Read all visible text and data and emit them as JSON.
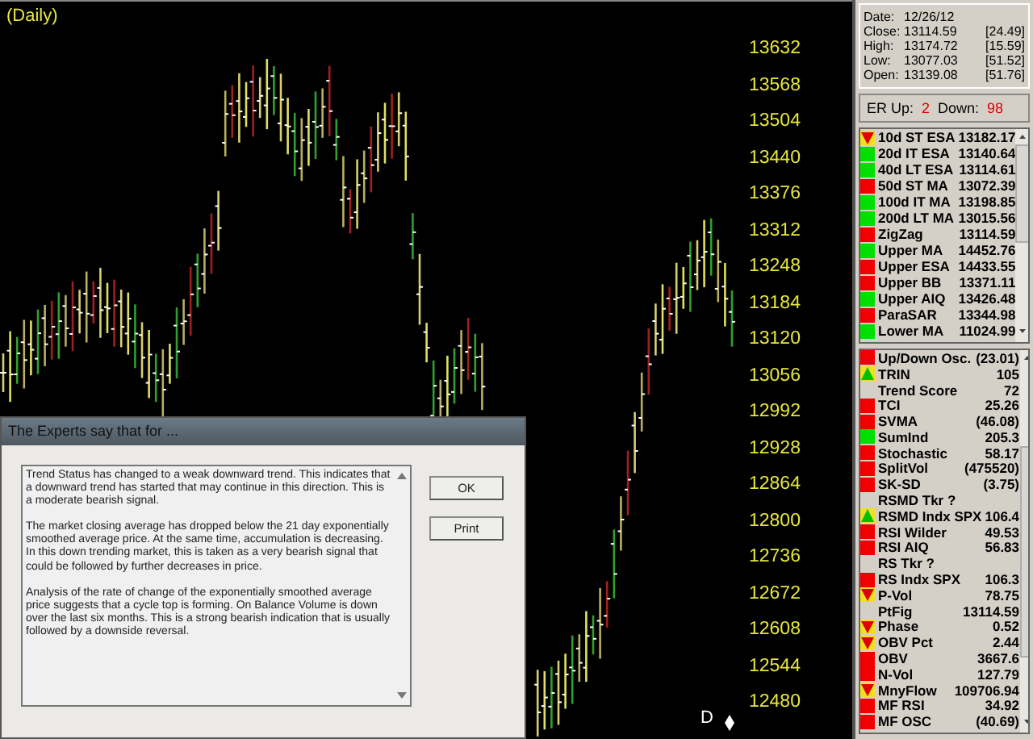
{
  "chart": {
    "period": "(Daily)",
    "price_axis": [
      "13632",
      "13568",
      "13504",
      "13440",
      "13376",
      "13312",
      "13248",
      "13184",
      "13120",
      "13056",
      "12992",
      "12928",
      "12864",
      "12800",
      "12736",
      "12672",
      "12608",
      "12544",
      "12480"
    ],
    "date_marker": "D"
  },
  "dialog": {
    "title": "The Experts say that for ...",
    "paragraphs": [
      "Trend Status has changed to a weak downward trend.  This indicates that a downward trend has started that may continue in this direction.  This is a moderate bearish signal.",
      "The market closing average has dropped below the 21  day exponentially smoothed average price.  At the  same time, accumulation is decreasing. In this down trending market, this is taken as a very bearish signal that could be followed by further decreases in price.",
      "Analysis of the rate of change of the exponentially smoothed average price suggests that a cycle top is forming.  On Balance Volume is down over the last six months. This is a strong bearish indication  that is usually followed by a downside reversal."
    ],
    "buttons": [
      "OK",
      "Print"
    ]
  },
  "quote": [
    {
      "label": "Date:",
      "value": "12/26/12"
    },
    {
      "label": "Close:",
      "value": "13114.59",
      "change": "[24.49]"
    },
    {
      "label": "High:",
      "value": "13174.72",
      "change": "[15.59]"
    },
    {
      "label": "Low:",
      "value": "13077.03",
      "change": "[51.52]"
    },
    {
      "label": "Open:",
      "value": "13139.08",
      "change": "[51.76]"
    }
  ],
  "expert_rating": {
    "up_label": "ER Up:",
    "up": "2",
    "down_label": "Down:",
    "down": "98"
  },
  "indicators": [
    {
      "kind": "falling",
      "name": "10d ST ESA",
      "value": "13182.17"
    },
    {
      "kind": "bullish",
      "name": "20d IT ESA",
      "value": "13140.64"
    },
    {
      "kind": "bullish",
      "name": "40d LT ESA",
      "value": "13114.61"
    },
    {
      "kind": "bearish",
      "name": "50d ST MA",
      "value": "13072.39"
    },
    {
      "kind": "bullish",
      "name": "100d IT MA",
      "value": "13198.85"
    },
    {
      "kind": "bullish",
      "name": "200d LT MA",
      "value": "13015.56"
    },
    {
      "kind": "bearish",
      "name": "ZigZag",
      "value": "13114.59"
    },
    {
      "kind": "bullish",
      "name": "Upper MA",
      "value": "14452.76"
    },
    {
      "kind": "bearish",
      "name": "Upper ESA",
      "value": "14433.55"
    },
    {
      "kind": "bearish",
      "name": "Upper BB",
      "value": "13371.11"
    },
    {
      "kind": "bullish",
      "name": "Upper AIQ",
      "value": "13426.48"
    },
    {
      "kind": "bearish",
      "name": "ParaSAR",
      "value": "13344.98"
    },
    {
      "kind": "bullish",
      "name": "Lower MA",
      "value": "11024.99"
    }
  ],
  "oscillators": [
    {
      "kind": "bearish",
      "name": "Up/Down Osc.",
      "value": "(23.01)"
    },
    {
      "kind": "rising",
      "name": "TRIN",
      "value": "105"
    },
    {
      "kind": "none",
      "name": "Trend Score",
      "value": "72"
    },
    {
      "kind": "bearish",
      "name": "TCI",
      "value": "25.26"
    },
    {
      "kind": "bearish",
      "name": "SVMA",
      "value": "(46.08)"
    },
    {
      "kind": "bullish",
      "name": "SumInd",
      "value": "205.3"
    },
    {
      "kind": "bearish",
      "name": "Stochastic",
      "value": "58.17"
    },
    {
      "kind": "bearish",
      "name": "SplitVol",
      "value": "(475520)"
    },
    {
      "kind": "bearish",
      "name": "SK-SD",
      "value": "(3.75)"
    },
    {
      "kind": "none",
      "name": "RSMD Tkr ?"
    },
    {
      "kind": "rising",
      "name": "RSMD Indx SPX",
      "value": "106.4"
    },
    {
      "kind": "bearish",
      "name": "RSI Wilder",
      "value": "49.53"
    },
    {
      "kind": "bearish",
      "name": "RSI AIQ",
      "value": "56.83"
    },
    {
      "kind": "none",
      "name": "RS Tkr ?"
    },
    {
      "kind": "bearish",
      "name": "RS Indx SPX",
      "value": "106.3"
    },
    {
      "kind": "falling",
      "name": "P-Vol",
      "value": "78.75"
    },
    {
      "kind": "none",
      "name": "PtFig",
      "value": "13114.59"
    },
    {
      "kind": "falling",
      "name": "Phase",
      "value": "0.52"
    },
    {
      "kind": "falling",
      "name": "OBV Pct",
      "value": "2.44"
    },
    {
      "kind": "bearish",
      "name": "OBV",
      "value": "3667.6"
    },
    {
      "kind": "bearish",
      "name": "N-Vol",
      "value": "127.79"
    },
    {
      "kind": "falling",
      "name": "MnyFlow",
      "value": "109706.94"
    },
    {
      "kind": "bearish",
      "name": "MF RSI",
      "value": "34.92"
    },
    {
      "kind": "bearish",
      "name": "MF OSC",
      "value": "(40.69)"
    }
  ]
}
